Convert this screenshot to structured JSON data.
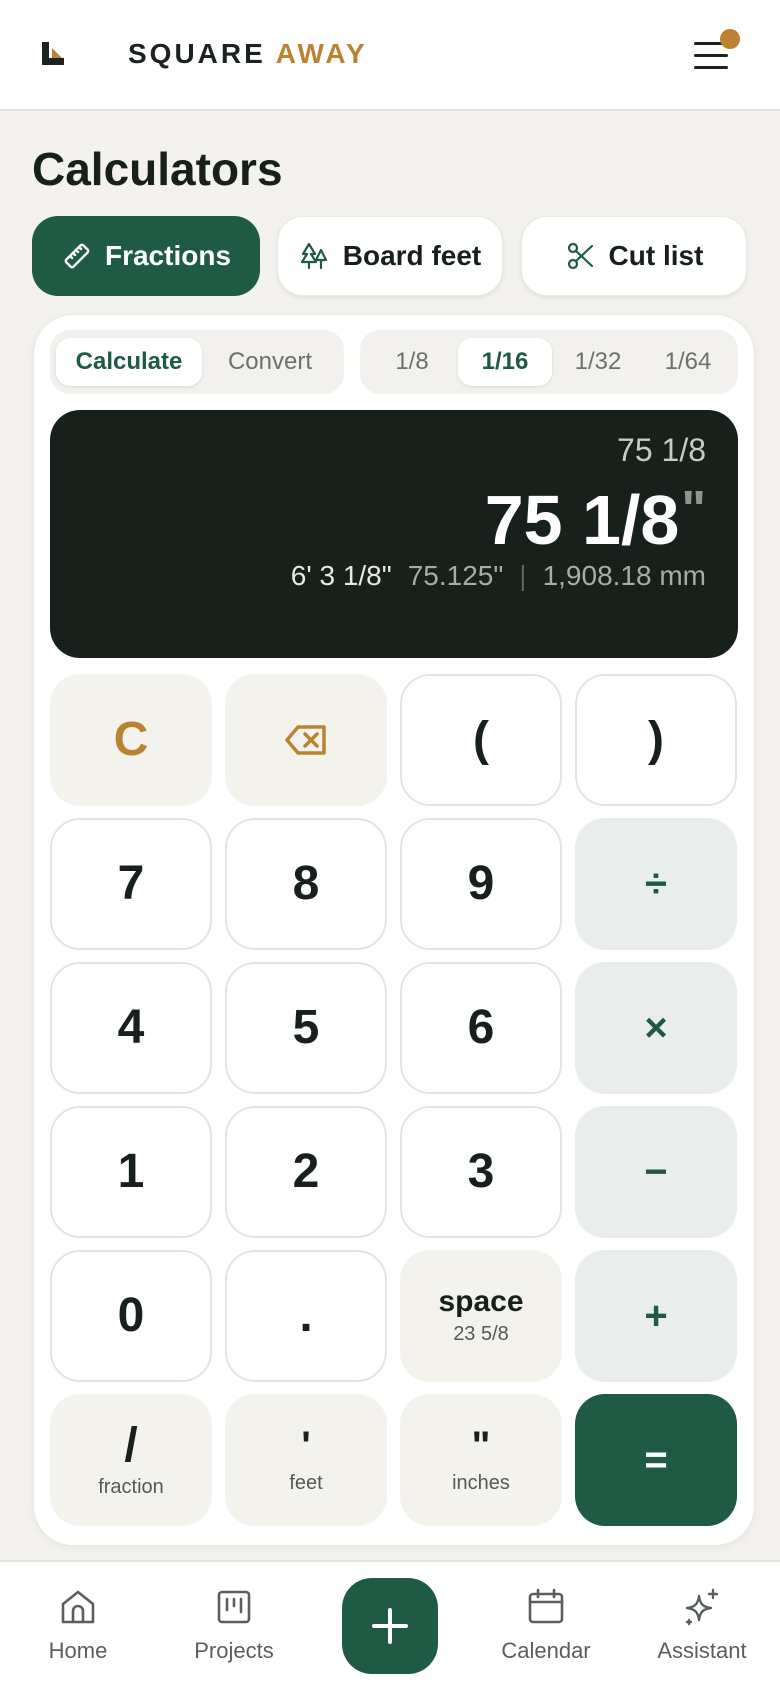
{
  "header": {
    "brand_word1": "SQUARE",
    "brand_word2": "AWAY",
    "accent_color": "#b98332",
    "brand_color": "#1e5a44"
  },
  "page": {
    "title": "Calculators"
  },
  "tool_tabs": [
    {
      "label": "Fractions",
      "icon": "ruler-icon",
      "active": true
    },
    {
      "label": "Board feet",
      "icon": "trees-icon",
      "active": false
    },
    {
      "label": "Cut list",
      "icon": "scissors-icon",
      "active": false
    }
  ],
  "mode_tabs": [
    {
      "label": "Calculate",
      "active": true
    },
    {
      "label": "Convert",
      "active": false
    }
  ],
  "precision_tabs": [
    {
      "label": "1/8",
      "active": false
    },
    {
      "label": "1/16",
      "active": true
    },
    {
      "label": "1/32",
      "active": false
    },
    {
      "label": "1/64",
      "active": false
    }
  ],
  "display": {
    "expression": "75 1/8",
    "result": "75 1/8",
    "result_unit": "\"",
    "feet_inches": "6' 3 1/8\"",
    "decimal_inches": "75.125\"",
    "millimeters": "1,908.18 mm"
  },
  "keys": {
    "clear": "C",
    "open_paren": "(",
    "close_paren": ")",
    "divide": "÷",
    "multiply": "×",
    "minus": "−",
    "plus": "+",
    "equals": "=",
    "seven": "7",
    "eight": "8",
    "nine": "9",
    "four": "4",
    "five": "5",
    "six": "6",
    "one": "1",
    "two": "2",
    "three": "3",
    "zero": "0",
    "dot": ".",
    "space": "space",
    "space_hint": "23 5/8",
    "fraction": "/",
    "fraction_label": "fraction",
    "feet": "'",
    "feet_label": "feet",
    "inches": "\"",
    "inches_label": "inches"
  },
  "bottom_nav": [
    {
      "label": "Home",
      "icon": "home-icon"
    },
    {
      "label": "Projects",
      "icon": "projects-icon"
    },
    {
      "label": "Calendar",
      "icon": "calendar-icon"
    },
    {
      "label": "Assistant",
      "icon": "sparkle-icon"
    }
  ]
}
